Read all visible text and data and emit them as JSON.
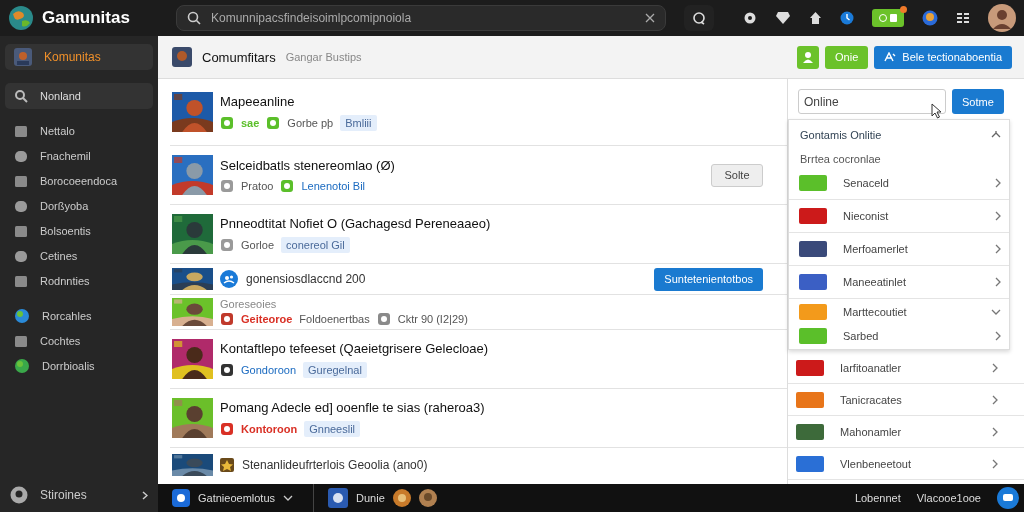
{
  "topbar": {
    "brand": "Gamunitas",
    "search": {
      "placeholder": "Komunnipacsfindeisoimlpcomipnoiola"
    },
    "badge": {
      "unread": true
    }
  },
  "sidebar": {
    "items": [
      {
        "label": "Komunitas",
        "selected": true
      },
      {
        "label": "Nonland",
        "selected": false
      },
      {
        "label": "Nettalo",
        "selected": false
      },
      {
        "label": "Fnachemil",
        "selected": false
      },
      {
        "label": "Borocoeendoca",
        "selected": false
      },
      {
        "label": "Dorßyoba",
        "selected": false
      },
      {
        "label": "Bolsoentis",
        "selected": false
      },
      {
        "label": "Cetines",
        "selected": false
      },
      {
        "label": "Rodnnties",
        "selected": false
      },
      {
        "label": "Rorcahles",
        "selected": false
      },
      {
        "label": "Cochtes",
        "selected": false
      },
      {
        "label": "Dorrbioalis",
        "selected": false
      }
    ],
    "footer": "Stiroines"
  },
  "header": {
    "title": "Comumfitars",
    "subtitle": "Gangar Bustips",
    "buttons": [
      {
        "kind": "icon"
      },
      {
        "kind": "green",
        "label": "Onie"
      },
      {
        "kind": "primary",
        "label": "Bele tectionaboentia"
      }
    ]
  },
  "posts": [
    {
      "kind": "full",
      "title": "Mapeeanline",
      "meta": [
        {
          "kind": "icon",
          "color": "#5bbf2a"
        },
        {
          "kind": "alert",
          "text": "sae",
          "color": "#5bbf2a"
        },
        {
          "kind": "icon",
          "color": "#5bbf2a"
        },
        {
          "kind": "text",
          "text": "Gorbe pþ"
        },
        {
          "kind": "tag",
          "text": "Bmliii"
        }
      ]
    },
    {
      "kind": "full",
      "title": "Selceidbatls stenereomlao (Ø)",
      "button": {
        "kind": "plain",
        "label": "Solte"
      },
      "meta": [
        {
          "kind": "icon",
          "color": "#9a9a9a"
        },
        {
          "kind": "text",
          "text": "Pratoo"
        },
        {
          "kind": "icon",
          "color": "#5bbf2a"
        },
        {
          "kind": "link",
          "text": "Lenenotoi Bil"
        }
      ]
    },
    {
      "kind": "full",
      "title": "Pnneodtitat Nofiet O (Gachagesd Pereneaaeo)",
      "meta": [
        {
          "kind": "icon",
          "color": "#9a9a9a"
        },
        {
          "kind": "text",
          "text": "Gorloe"
        },
        {
          "kind": "tag",
          "text": "conereol Gil"
        }
      ]
    },
    {
      "kind": "compact",
      "title": "gonensiosdlaccnd 200",
      "button": {
        "kind": "primary",
        "label": "Suntetenientotbos"
      }
    },
    {
      "kind": "sub",
      "caption": "Goreseoies",
      "meta": [
        {
          "kind": "icon",
          "color": "#c0392b"
        },
        {
          "kind": "alert",
          "text": "Geiteoroe",
          "color": "#d93025"
        },
        {
          "kind": "text",
          "text": "Foldoenertbas"
        },
        {
          "kind": "icon",
          "color": "#8a8a8a"
        },
        {
          "kind": "text",
          "text": "Cktr 90  (I2|29)"
        }
      ]
    },
    {
      "kind": "full",
      "title": "Kontaftlepo tefeeset (Qaeietgrisere Gelecloae)",
      "meta": [
        {
          "kind": "icon",
          "color": "#333333"
        },
        {
          "kind": "link",
          "text": "Gondoroon"
        },
        {
          "kind": "tag",
          "text": "Guregelnal"
        }
      ]
    },
    {
      "kind": "full",
      "title": "Pomang Adecle ed] ooenfle te sias (raheroa3)",
      "meta": [
        {
          "kind": "icon",
          "color": "#d93025"
        },
        {
          "kind": "alert",
          "text": "Kontoroon",
          "color": "#d93025"
        },
        {
          "kind": "tag",
          "text": "Gnneeslil"
        }
      ]
    },
    {
      "kind": "cut",
      "title": "Stenanlideufrterlois Geoolia (ano0)"
    }
  ],
  "panel": {
    "search": {
      "value": "Online"
    },
    "button": "Sotme",
    "dropdown": {
      "title": "Gontamis Onlitie",
      "subtitle": "Brrtea cocronlae",
      "items": [
        {
          "label": "Senaceld",
          "color": "#5bbf2a",
          "expanded": false
        },
        {
          "label": "Nieconist",
          "color": "#cc1a1a",
          "expanded": false
        },
        {
          "label": "Merfoamerlet",
          "color": "#3a4a7a",
          "expanded": false
        },
        {
          "label": "Maneeatinlet",
          "color": "#3b5fc4",
          "expanded": false
        },
        {
          "label": "Marttecoutiet",
          "color": "#f39a1b",
          "expanded": true
        },
        {
          "label": "Sarbed",
          "color": "#5bbf2a",
          "expanded": false
        }
      ]
    },
    "items": [
      {
        "label": "Iarfitoanatler",
        "color": "#cc1a1a"
      },
      {
        "label": "Tanicracates",
        "color": "#e8751a"
      },
      {
        "label": "Mahonamler",
        "color": "#3d6a3a"
      },
      {
        "label": "Vlenbeneetout",
        "color": "#2a6fd6"
      }
    ]
  },
  "bottombar": {
    "left": "Gatnieoemlotus",
    "middle": "Dunie",
    "right": [
      "Lobennet",
      "Vlacooe1ooe"
    ]
  }
}
